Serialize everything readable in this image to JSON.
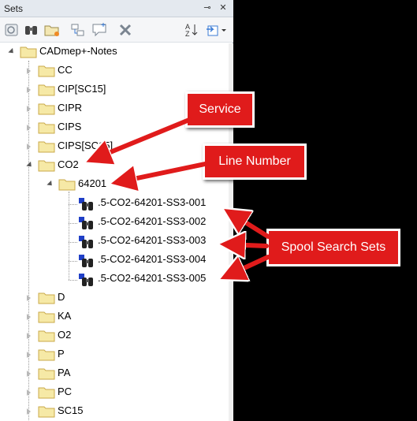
{
  "panel": {
    "title": "Sets",
    "pin_glyph": "⊸",
    "close_glyph": "✕"
  },
  "toolbar": {
    "tools": [
      {
        "name": "save-selection-icon"
      },
      {
        "name": "save-search-icon"
      },
      {
        "name": "new-folder-icon"
      },
      {
        "name": "duplicate-icon"
      },
      {
        "name": "add-comment-icon"
      },
      {
        "name": "delete-icon"
      },
      {
        "name": "sort-icon"
      },
      {
        "name": "import-export-icon"
      }
    ]
  },
  "tree": {
    "root": "CADmep+-Notes",
    "folders_top": [
      "CC",
      "CIP[SC15]",
      "CIPR",
      "CIPS",
      "CIPS[SC15]"
    ],
    "expanded_service": "CO2",
    "expanded_line": "64201",
    "search_sets": [
      ".5-CO2-64201-SS3-001",
      ".5-CO2-64201-SS3-002",
      ".5-CO2-64201-SS3-003",
      ".5-CO2-64201-SS3-004",
      ".5-CO2-64201-SS3-005"
    ],
    "folders_bottom": [
      "D",
      "KA",
      "O2",
      "P",
      "PA",
      "PC",
      "SC15"
    ]
  },
  "callouts": {
    "service": "Service",
    "line_number": "Line Number",
    "spool_search_sets": "Spool Search Sets"
  },
  "colors": {
    "callout_red": "#e01b1b",
    "folder_fill": "#f6e9a6",
    "folder_stroke": "#c9a94a",
    "background": "#000000"
  }
}
